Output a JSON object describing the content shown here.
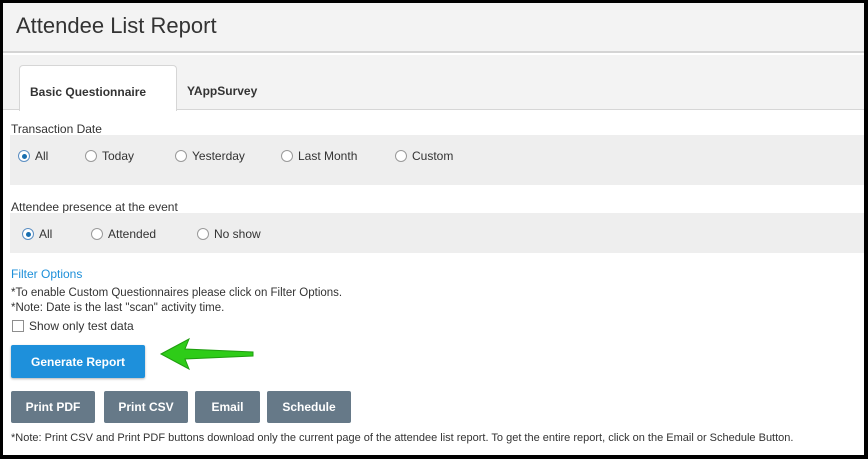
{
  "header": {
    "title": "Attendee List Report"
  },
  "tabs": [
    {
      "label": "Basic Questionnaire",
      "active": true
    },
    {
      "label": "YAppSurvey",
      "active": false
    }
  ],
  "transaction_date": {
    "label": "Transaction Date",
    "options": [
      "All",
      "Today",
      "Yesterday",
      "Last Month",
      "Custom"
    ],
    "selected": "All"
  },
  "presence": {
    "label": "Attendee presence at the event",
    "options": [
      "All",
      "Attended",
      "No show"
    ],
    "selected": "All"
  },
  "filter_link": "Filter Options",
  "notes": {
    "custom_questionnaires": "*To enable Custom Questionnaires please click on Filter Options.",
    "date_note": "*Note: Date is the last \"scan\" activity time.",
    "print_note": "*Note: Print CSV and Print PDF buttons download only the current page of the attendee list report. To get the entire report, click on the Email or Schedule Button."
  },
  "test_data_checkbox": {
    "label": "Show only test data",
    "checked": false
  },
  "buttons": {
    "generate": "Generate Report",
    "print_pdf": "Print PDF",
    "print_csv": "Print CSV",
    "email": "Email",
    "schedule": "Schedule"
  },
  "colors": {
    "primary": "#1e90db",
    "secondary": "#667988",
    "link": "#1d8fd9",
    "arrow": "#2ecc18"
  },
  "icons": {
    "annotation": "green-arrow-icon"
  }
}
